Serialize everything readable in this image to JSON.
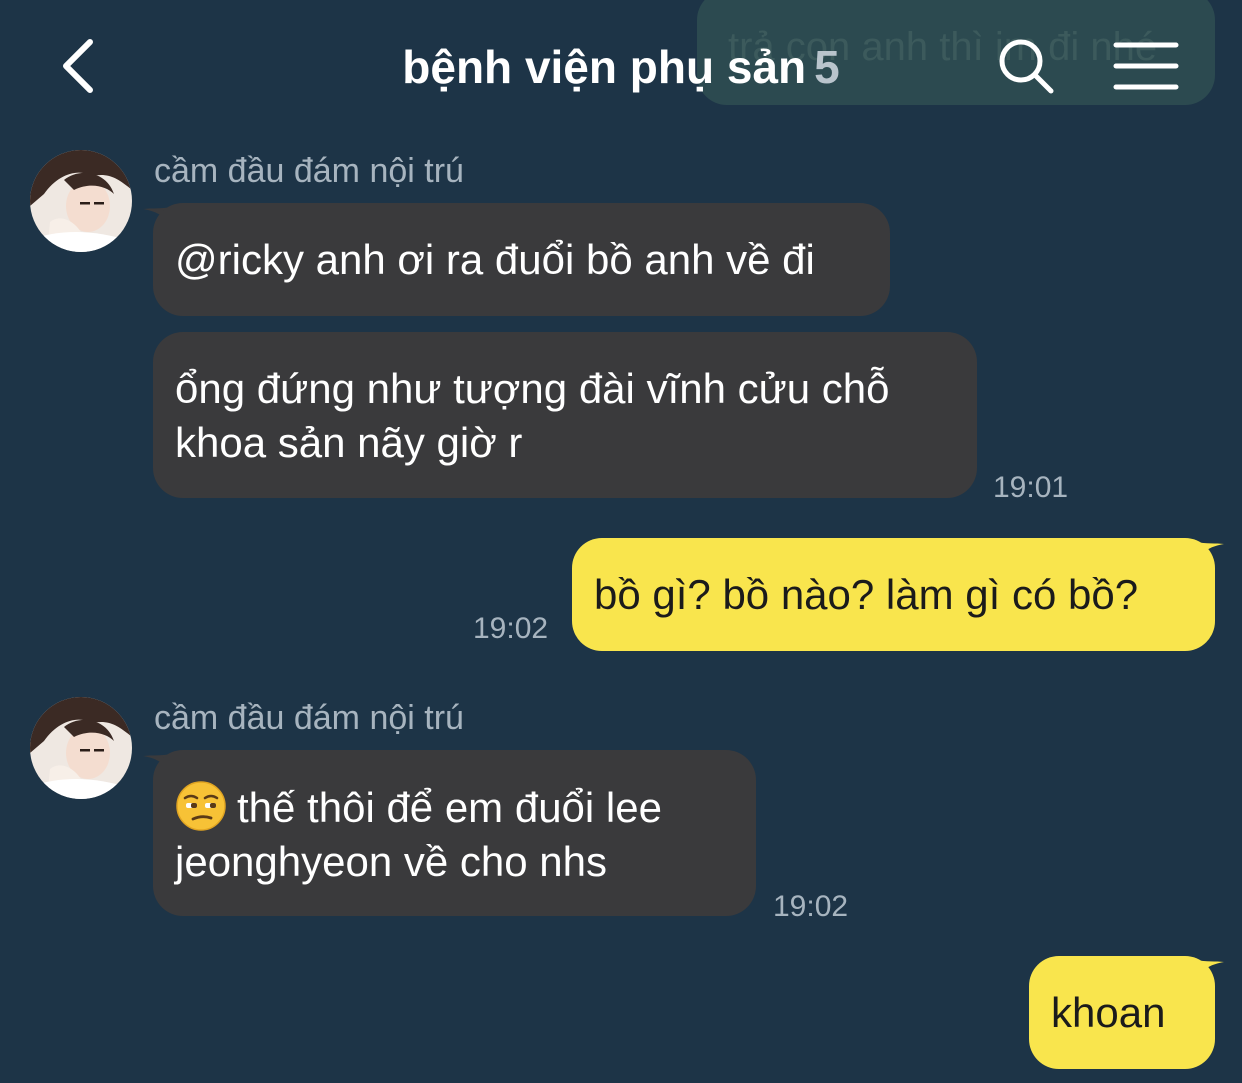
{
  "header": {
    "title": "bệnh viện phụ sản",
    "member_count": "5",
    "background_message": "trả con anh thì im đi nhé"
  },
  "messages": [
    {
      "sender": "cầm đầu đám nội trú",
      "text": "@ricky anh ơi ra đuổi bồ anh về đi",
      "direction": "in"
    },
    {
      "text_lines": [
        "ổng đứng như tượng đài vĩnh cửu chỗ",
        "khoa sản nãy giờ r"
      ],
      "time": "19:01",
      "direction": "in"
    },
    {
      "text": "bồ gì? bồ nào? làm gì có bồ?",
      "time": "19:02",
      "direction": "out"
    },
    {
      "sender": "cầm đầu đám nội trú",
      "emoji": "unamused-face",
      "text_lines": [
        "thế thôi để em đuổi lee",
        "jeonghyeon về cho nhs"
      ],
      "time": "19:02",
      "direction": "in"
    },
    {
      "text": "khoan",
      "direction": "out"
    }
  ],
  "colors": {
    "background": "#1d3447",
    "incoming_bubble": "#3a3a3c",
    "outgoing_bubble": "#f9e54d",
    "meta_text": "#a7b4bf"
  }
}
